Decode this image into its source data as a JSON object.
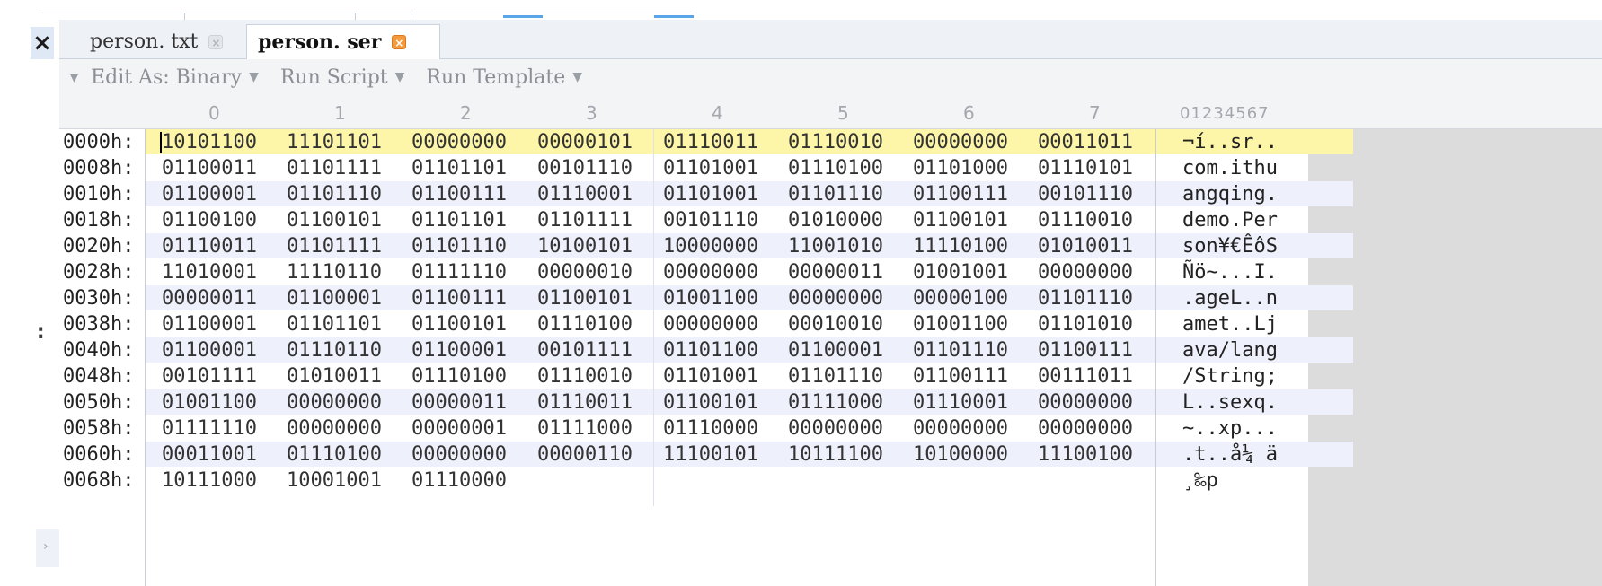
{
  "tabs": [
    {
      "label": "person. txt",
      "active": false
    },
    {
      "label": "person. ser",
      "active": true
    }
  ],
  "toolbar": {
    "edit_as": "Edit As: Binary",
    "run_script": "Run Script",
    "run_template": "Run Template"
  },
  "icons": {
    "close": "close-icon",
    "dropdown": "chevron-down-icon",
    "grip": "toolbar-grip-icon",
    "left_marker": ":"
  },
  "columns": [
    "0",
    "1",
    "2",
    "3",
    "4",
    "5",
    "6",
    "7"
  ],
  "ascii_header": "01234567",
  "rows": [
    {
      "offset": "0000h:",
      "bytes": [
        "10101100",
        "11101101",
        "00000000",
        "00000101",
        "01110011",
        "01110010",
        "00000000",
        "00011011"
      ],
      "ascii": "¬í..sr.."
    },
    {
      "offset": "0008h:",
      "bytes": [
        "01100011",
        "01101111",
        "01101101",
        "00101110",
        "01101001",
        "01110100",
        "01101000",
        "01110101"
      ],
      "ascii": "com.ithu"
    },
    {
      "offset": "0010h:",
      "bytes": [
        "01100001",
        "01101110",
        "01100111",
        "01110001",
        "01101001",
        "01101110",
        "01100111",
        "00101110"
      ],
      "ascii": "angqing."
    },
    {
      "offset": "0018h:",
      "bytes": [
        "01100100",
        "01100101",
        "01101101",
        "01101111",
        "00101110",
        "01010000",
        "01100101",
        "01110010"
      ],
      "ascii": "demo.Per"
    },
    {
      "offset": "0020h:",
      "bytes": [
        "01110011",
        "01101111",
        "01101110",
        "10100101",
        "10000000",
        "11001010",
        "11110100",
        "01010011"
      ],
      "ascii": "son¥€ÊôS"
    },
    {
      "offset": "0028h:",
      "bytes": [
        "11010001",
        "11110110",
        "01111110",
        "00000010",
        "00000000",
        "00000011",
        "01001001",
        "00000000"
      ],
      "ascii": "Ñö~...I."
    },
    {
      "offset": "0030h:",
      "bytes": [
        "00000011",
        "01100001",
        "01100111",
        "01100101",
        "01001100",
        "00000000",
        "00000100",
        "01101110"
      ],
      "ascii": ".ageL..n"
    },
    {
      "offset": "0038h:",
      "bytes": [
        "01100001",
        "01101101",
        "01100101",
        "01110100",
        "00000000",
        "00010010",
        "01001100",
        "01101010"
      ],
      "ascii": "amet..Lj"
    },
    {
      "offset": "0040h:",
      "bytes": [
        "01100001",
        "01110110",
        "01100001",
        "00101111",
        "01101100",
        "01100001",
        "01101110",
        "01100111"
      ],
      "ascii": "ava/lang"
    },
    {
      "offset": "0048h:",
      "bytes": [
        "00101111",
        "01010011",
        "01110100",
        "01110010",
        "01101001",
        "01101110",
        "01100111",
        "00111011"
      ],
      "ascii": "/String;"
    },
    {
      "offset": "0050h:",
      "bytes": [
        "01001100",
        "00000000",
        "00000011",
        "01110011",
        "01100101",
        "01111000",
        "01110001",
        "00000000"
      ],
      "ascii": "L..sexq."
    },
    {
      "offset": "0058h:",
      "bytes": [
        "01111110",
        "00000000",
        "00000001",
        "01111000",
        "01110000",
        "00000000",
        "00000000",
        "00000000"
      ],
      "ascii": "~..xp..."
    },
    {
      "offset": "0060h:",
      "bytes": [
        "00011001",
        "01110100",
        "00000000",
        "00000110",
        "11100101",
        "10111100",
        "10100000",
        "11100100"
      ],
      "ascii": ".t..å¼ ä"
    },
    {
      "offset": "0068h:",
      "bytes": [
        "10111000",
        "10001001",
        "01110000"
      ],
      "ascii": "¸‰p"
    }
  ]
}
